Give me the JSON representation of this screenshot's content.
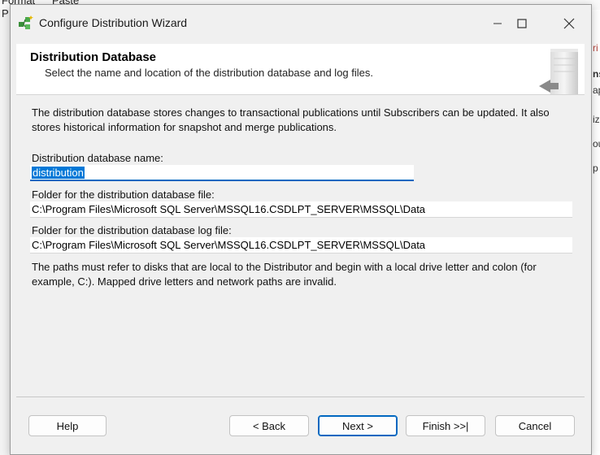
{
  "background_app": {
    "top_fragments": [
      "Format",
      "Paste"
    ],
    "left_fragment": "P",
    "right_fragments": [
      "ri",
      "ns",
      "ap",
      "iz",
      "ou",
      "p"
    ]
  },
  "window": {
    "title": "Configure Distribution Wizard",
    "icons": {
      "app": "wizard-icon",
      "minimize": "minimize-icon",
      "maximize": "maximize-icon",
      "close": "close-icon"
    }
  },
  "header": {
    "title": "Distribution Database",
    "subtitle": "Select the name and location of the distribution database and log files."
  },
  "body": {
    "description": "The distribution database stores changes to transactional publications until Subscribers can be updated. It also stores historical information for snapshot and merge publications.",
    "db_name_label": "Distribution database name:",
    "db_name_value": "distribution",
    "data_folder_label": "Folder for the distribution database file:",
    "data_folder_value": "C:\\Program Files\\Microsoft SQL Server\\MSSQL16.CSDLPT_SERVER\\MSSQL\\Data",
    "log_folder_label": "Folder for the distribution database log file:",
    "log_folder_value": "C:\\Program Files\\Microsoft SQL Server\\MSSQL16.CSDLPT_SERVER\\MSSQL\\Data",
    "note": "The paths must refer to disks that are local to the Distributor and begin with a local drive letter and colon (for example, C:). Mapped drive letters and network paths are invalid."
  },
  "buttons": {
    "help": "Help",
    "back": "< Back",
    "next": "Next >",
    "finish": "Finish >>|",
    "cancel": "Cancel"
  },
  "colors": {
    "accent": "#0067c0",
    "selection": "#0078d7"
  }
}
